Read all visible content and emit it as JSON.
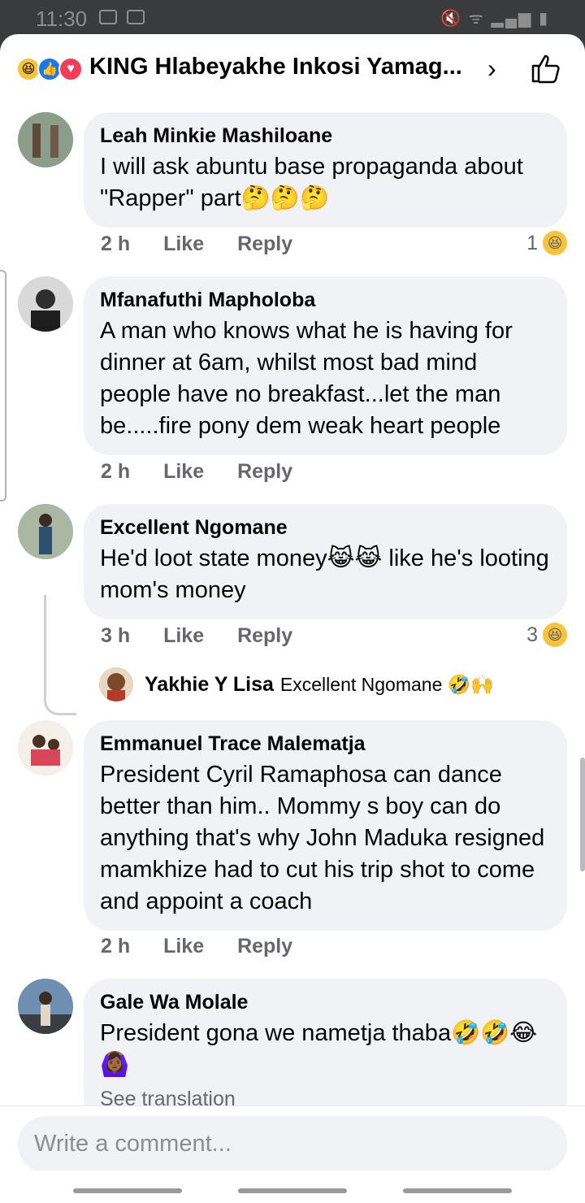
{
  "status_bar": {
    "time": "11:30"
  },
  "header": {
    "title": "KING Hlabeyakhe Inkosi Yamag...",
    "reactions": [
      "haha-icon",
      "like-icon",
      "love-icon"
    ]
  },
  "comments": [
    {
      "name": "Leah Minkie Mashiloane",
      "text": "I will ask abuntu base propaganda about  \"Rapper\" part🤔🤔🤔",
      "time": "2 h",
      "like": "Like",
      "reply": "Reply",
      "reaction_count": "1",
      "reaction_emoji": "😆"
    },
    {
      "name": "Mfanafuthi Mapholoba",
      "text": "A man who knows what he is having for dinner at 6am, whilst most bad mind people have no breakfast...let the man be.....fire pony dem weak heart people",
      "time": "2 h",
      "like": "Like",
      "reply": "Reply"
    },
    {
      "name": "Excellent Ngomane",
      "text": "He'd loot state money😹😹 like he's looting mom's money",
      "time": "3 h",
      "like": "Like",
      "reply": "Reply",
      "reaction_count": "3",
      "reaction_emoji": "😆"
    },
    {
      "name": "Emmanuel Trace Malematja",
      "text": "President Cyril Ramaphosa can dance better than him.. Mommy s boy can do anything that's why John Maduka resigned mamkhize had to cut his trip shot to come and appoint a coach",
      "time": "2 h",
      "like": "Like",
      "reply": "Reply"
    },
    {
      "name": "Gale Wa Molale",
      "text": "President gona we nametja thaba🤣🤣😂🙆🏾‍♀️",
      "see_translation": "See translation"
    }
  ],
  "reply_preview": {
    "name": "Yakhie Y Lisa",
    "text": "Excellent Ngomane 🤣🙌"
  },
  "composer": {
    "placeholder": "Write a comment..."
  }
}
